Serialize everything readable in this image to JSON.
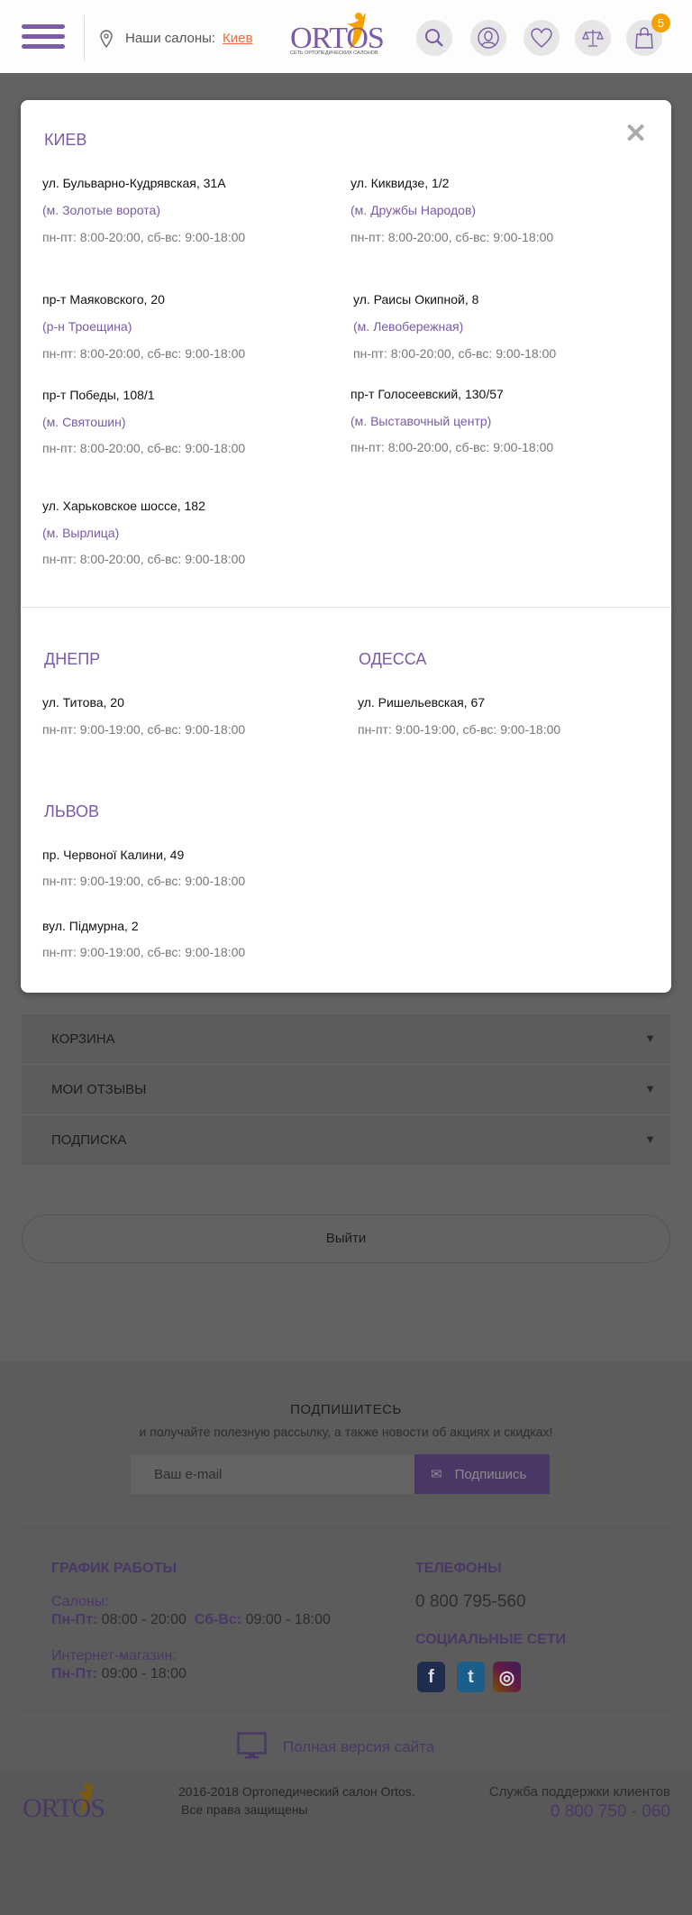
{
  "header": {
    "salons_label": "Наши салоны:",
    "city_link": "Киев",
    "logo_text": "ORTOS",
    "logo_tagline": "СЕТЬ ОРТОПЕДИЧЕСКИХ САЛОНОВ",
    "cart_count": "5",
    "icons": [
      "menu-icon",
      "location-pin-icon",
      "search-icon",
      "user-icon",
      "heart-icon",
      "compare-scales-icon",
      "shopping-bag-icon"
    ]
  },
  "modal": {
    "close_icon": "close-icon",
    "kiev": {
      "title": "Киев",
      "salons": [
        {
          "address": "ул. Бульварно-Кудрявская, 31А",
          "metro": "(м. Золотые ворота)",
          "hours": "пн-пт: 8:00-20:00, сб-вс: 9:00-18:00"
        },
        {
          "address": "ул. Киквидзе, 1/2",
          "metro": "(м. Дружбы Народов)",
          "hours": "пн-пт: 8:00-20:00, сб-вс: 9:00-18:00"
        },
        {
          "address": "пр-т Маяковского, 20",
          "metro": "(р-н Троещина)",
          "hours": "пн-пт: 8:00-20:00, сб-вс: 9:00-18:00"
        },
        {
          "address": "ул. Раисы Окипной, 8",
          "metro": "(м. Левобережная)",
          "hours": "пн-пт: 8:00-20:00, сб-вс: 9:00-18:00"
        },
        {
          "address": "пр-т Победы, 108/1",
          "metro": "(м. Святошин)",
          "hours": "пн-пт: 8:00-20:00, сб-вс: 9:00-18:00"
        },
        {
          "address": "пр-т Голосеевский, 130/57",
          "metro": "(м. Выставочный центр)",
          "hours": "пн-пт: 8:00-20:00, сб-вс: 9:00-18:00"
        },
        {
          "address": "ул. Харьковское шоссе, 182",
          "metro": "(м. Вырлица)",
          "hours": "пн-пт: 8:00-20:00, сб-вс: 9:00-18:00"
        }
      ]
    },
    "dnepr": {
      "title": "Днепр",
      "salons": [
        {
          "address": "ул. Титова, 20",
          "hours": "пн-пт: 9:00-19:00, сб-вс: 9:00-18:00"
        }
      ]
    },
    "odessa": {
      "title": "Одесса",
      "salons": [
        {
          "address": "ул. Ришельевская, 67",
          "hours": "пн-пт: 9:00-19:00, сб-вс: 9:00-18:00"
        }
      ]
    },
    "lviv": {
      "title": "Львов",
      "salons": [
        {
          "address": "пр. Червоної Калини, 49",
          "hours": "пн-пт: 9:00-19:00, сб-вс: 9:00-18:00"
        },
        {
          "address": "вул. Підмурна, 2",
          "hours": "пн-пт: 9:00-19:00, сб-вс: 9:00-18:00"
        }
      ]
    }
  },
  "account": {
    "accordion": [
      {
        "label": "Корзина"
      },
      {
        "label": "Мои отзывы"
      },
      {
        "label": "Подписка"
      }
    ],
    "logout": "Выйти"
  },
  "subscribe": {
    "title": "ПОДПИШИТЕСЬ",
    "subtitle": "и получайте полезную рассылку, а также новости об акциях и скидках!",
    "placeholder": "Ваш e-mail",
    "button": "Подпишись"
  },
  "footer": {
    "schedule_title": "ГРАФИК РАБОТЫ",
    "salons_label": "Салоны:",
    "weekday_label": "Пн-Пт:",
    "weekday_hours": "08:00 - 20:00",
    "weekend_label": "Сб-Вс:",
    "weekend_hours": "09:00 - 18:00",
    "shop_label": "Интернет-магазин:",
    "shop_weekday_label": "Пн-Пт:",
    "shop_hours": "09:00 - 18:00",
    "phones_title": "ТЕЛЕФОНЫ",
    "phone": "0 800 795-560",
    "social_title": "СОЦИАЛЬНЫЕ СЕТИ",
    "social": [
      {
        "name": "facebook",
        "glyph": "f",
        "color": "#3b5998"
      },
      {
        "name": "twitter",
        "glyph": "t",
        "color": "#1da1f2"
      },
      {
        "name": "instagram",
        "glyph": "◎",
        "color": "#c13584"
      }
    ],
    "full_version": "Полная версия сайта",
    "copyright": "2016-2018  Ортопедический салон Ortos.",
    "rights": "Все права защищены",
    "support_label": "Служба поддержки клиентов",
    "support_phone": "0 800 750 - 060"
  },
  "colors": {
    "brand": "#7b5aa6",
    "accent": "#f26a3c",
    "badge": "#f5a200"
  }
}
